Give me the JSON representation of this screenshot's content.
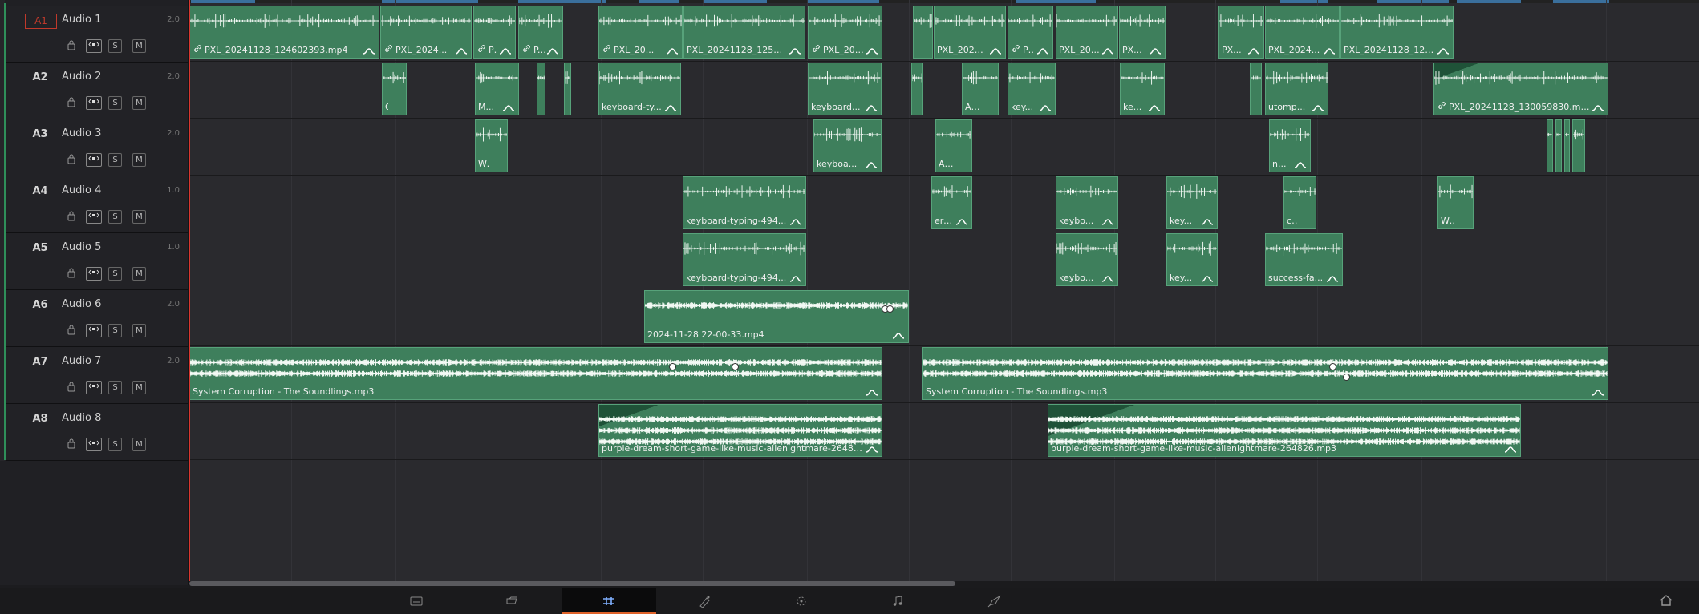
{
  "tracks": [
    {
      "id": "A1",
      "name": "Audio 1",
      "vol": "2.0",
      "selected": true,
      "clips": [
        {
          "label": "PXL_20241128_124602393.mp4",
          "linked": true
        },
        {
          "label": "PXL_2024...",
          "linked": true
        },
        {
          "label": "PX...",
          "linked": true
        },
        {
          "label": "P...",
          "linked": true
        },
        {
          "label": "PXL_20...",
          "linked": true
        },
        {
          "label": "PXL_20241128_125353974...",
          "linked": false
        },
        {
          "label": "PXL_2024...",
          "linked": true
        },
        {
          "label": "",
          "linked": false
        },
        {
          "label": "PXL_20241128...",
          "linked": false
        },
        {
          "label": "PX...",
          "linked": true
        },
        {
          "label": "PXL_20241...",
          "linked": false
        },
        {
          "label": "PX...",
          "linked": false
        },
        {
          "label": "PX...",
          "linked": false
        },
        {
          "label": "PXL_2024...",
          "linked": false
        },
        {
          "label": "PXL_20241128_12594029...",
          "linked": false
        }
      ]
    },
    {
      "id": "A2",
      "name": "Audio 2",
      "vol": "2.0",
      "clips": [
        {
          "label": "O..."
        },
        {
          "label": "M..."
        },
        {
          "label": ""
        },
        {
          "label": ""
        },
        {
          "label": "keyboard-ty..."
        },
        {
          "label": "keyboard..."
        },
        {
          "label": ""
        },
        {
          "label": "Alar..."
        },
        {
          "label": "key..."
        },
        {
          "label": "ke..."
        },
        {
          "label": ""
        },
        {
          "label": "utomp..."
        },
        {
          "label": "PXL_20241128_130059830.mp4",
          "linked": true
        }
      ]
    },
    {
      "id": "A3",
      "name": "Audio 3",
      "vol": "2.0",
      "clips": [
        {
          "label": "Win..."
        },
        {
          "label": "keyboa..."
        },
        {
          "label": "Alar..."
        },
        {
          "label": "n..."
        },
        {
          "label": ""
        },
        {
          "label": ""
        },
        {
          "label": ""
        },
        {
          "label": ""
        }
      ]
    },
    {
      "id": "A4",
      "name": "Audio 4",
      "vol": "1.0",
      "clips": [
        {
          "label": "keyboard-typing-494..."
        },
        {
          "label": "error-..."
        },
        {
          "label": "keybo..."
        },
        {
          "label": "key..."
        },
        {
          "label": "che..."
        },
        {
          "label": "Win..."
        }
      ]
    },
    {
      "id": "A5",
      "name": "Audio 5",
      "vol": "1.0",
      "clips": [
        {
          "label": "keyboard-typing-494..."
        },
        {
          "label": "keybo..."
        },
        {
          "label": "key..."
        },
        {
          "label": "success-fa..."
        }
      ]
    },
    {
      "id": "A6",
      "name": "Audio 6",
      "vol": "2.0",
      "clips": [
        {
          "label": "2024-11-28 22-00-33.mp4"
        }
      ]
    },
    {
      "id": "A7",
      "name": "Audio 7",
      "vol": "2.0",
      "clips": [
        {
          "label": "System Corruption - The Soundlings.mp3"
        },
        {
          "label": "System Corruption - The Soundlings.mp3"
        }
      ]
    },
    {
      "id": "A8",
      "name": "Audio 8",
      "vol": "",
      "clips": [
        {
          "label": "purple-dream-short-game-like-music-alienightmare-264826...."
        },
        {
          "label": "purple-dream-short-game-like-music-alienightmare-264826.mp3"
        }
      ]
    }
  ],
  "header_buttons": {
    "solo": "S",
    "mute": "M",
    "lock": "lock-icon",
    "aux": "auto-track-select-icon"
  },
  "pages": [
    {
      "name": "media-page-icon",
      "active": false
    },
    {
      "name": "cut-page-icon",
      "active": false
    },
    {
      "name": "edit-page-icon",
      "active": true
    },
    {
      "name": "fusion-page-icon",
      "active": false
    },
    {
      "name": "color-page-icon",
      "active": false
    },
    {
      "name": "fairlight-page-icon",
      "active": false
    },
    {
      "name": "deliver-page-icon",
      "active": false
    }
  ],
  "home": "home-icon",
  "colors": {
    "clip": "#3e7f5c",
    "clip_border": "#57a27a",
    "playhead": "#d9362e",
    "active_page": "#e0632a"
  }
}
